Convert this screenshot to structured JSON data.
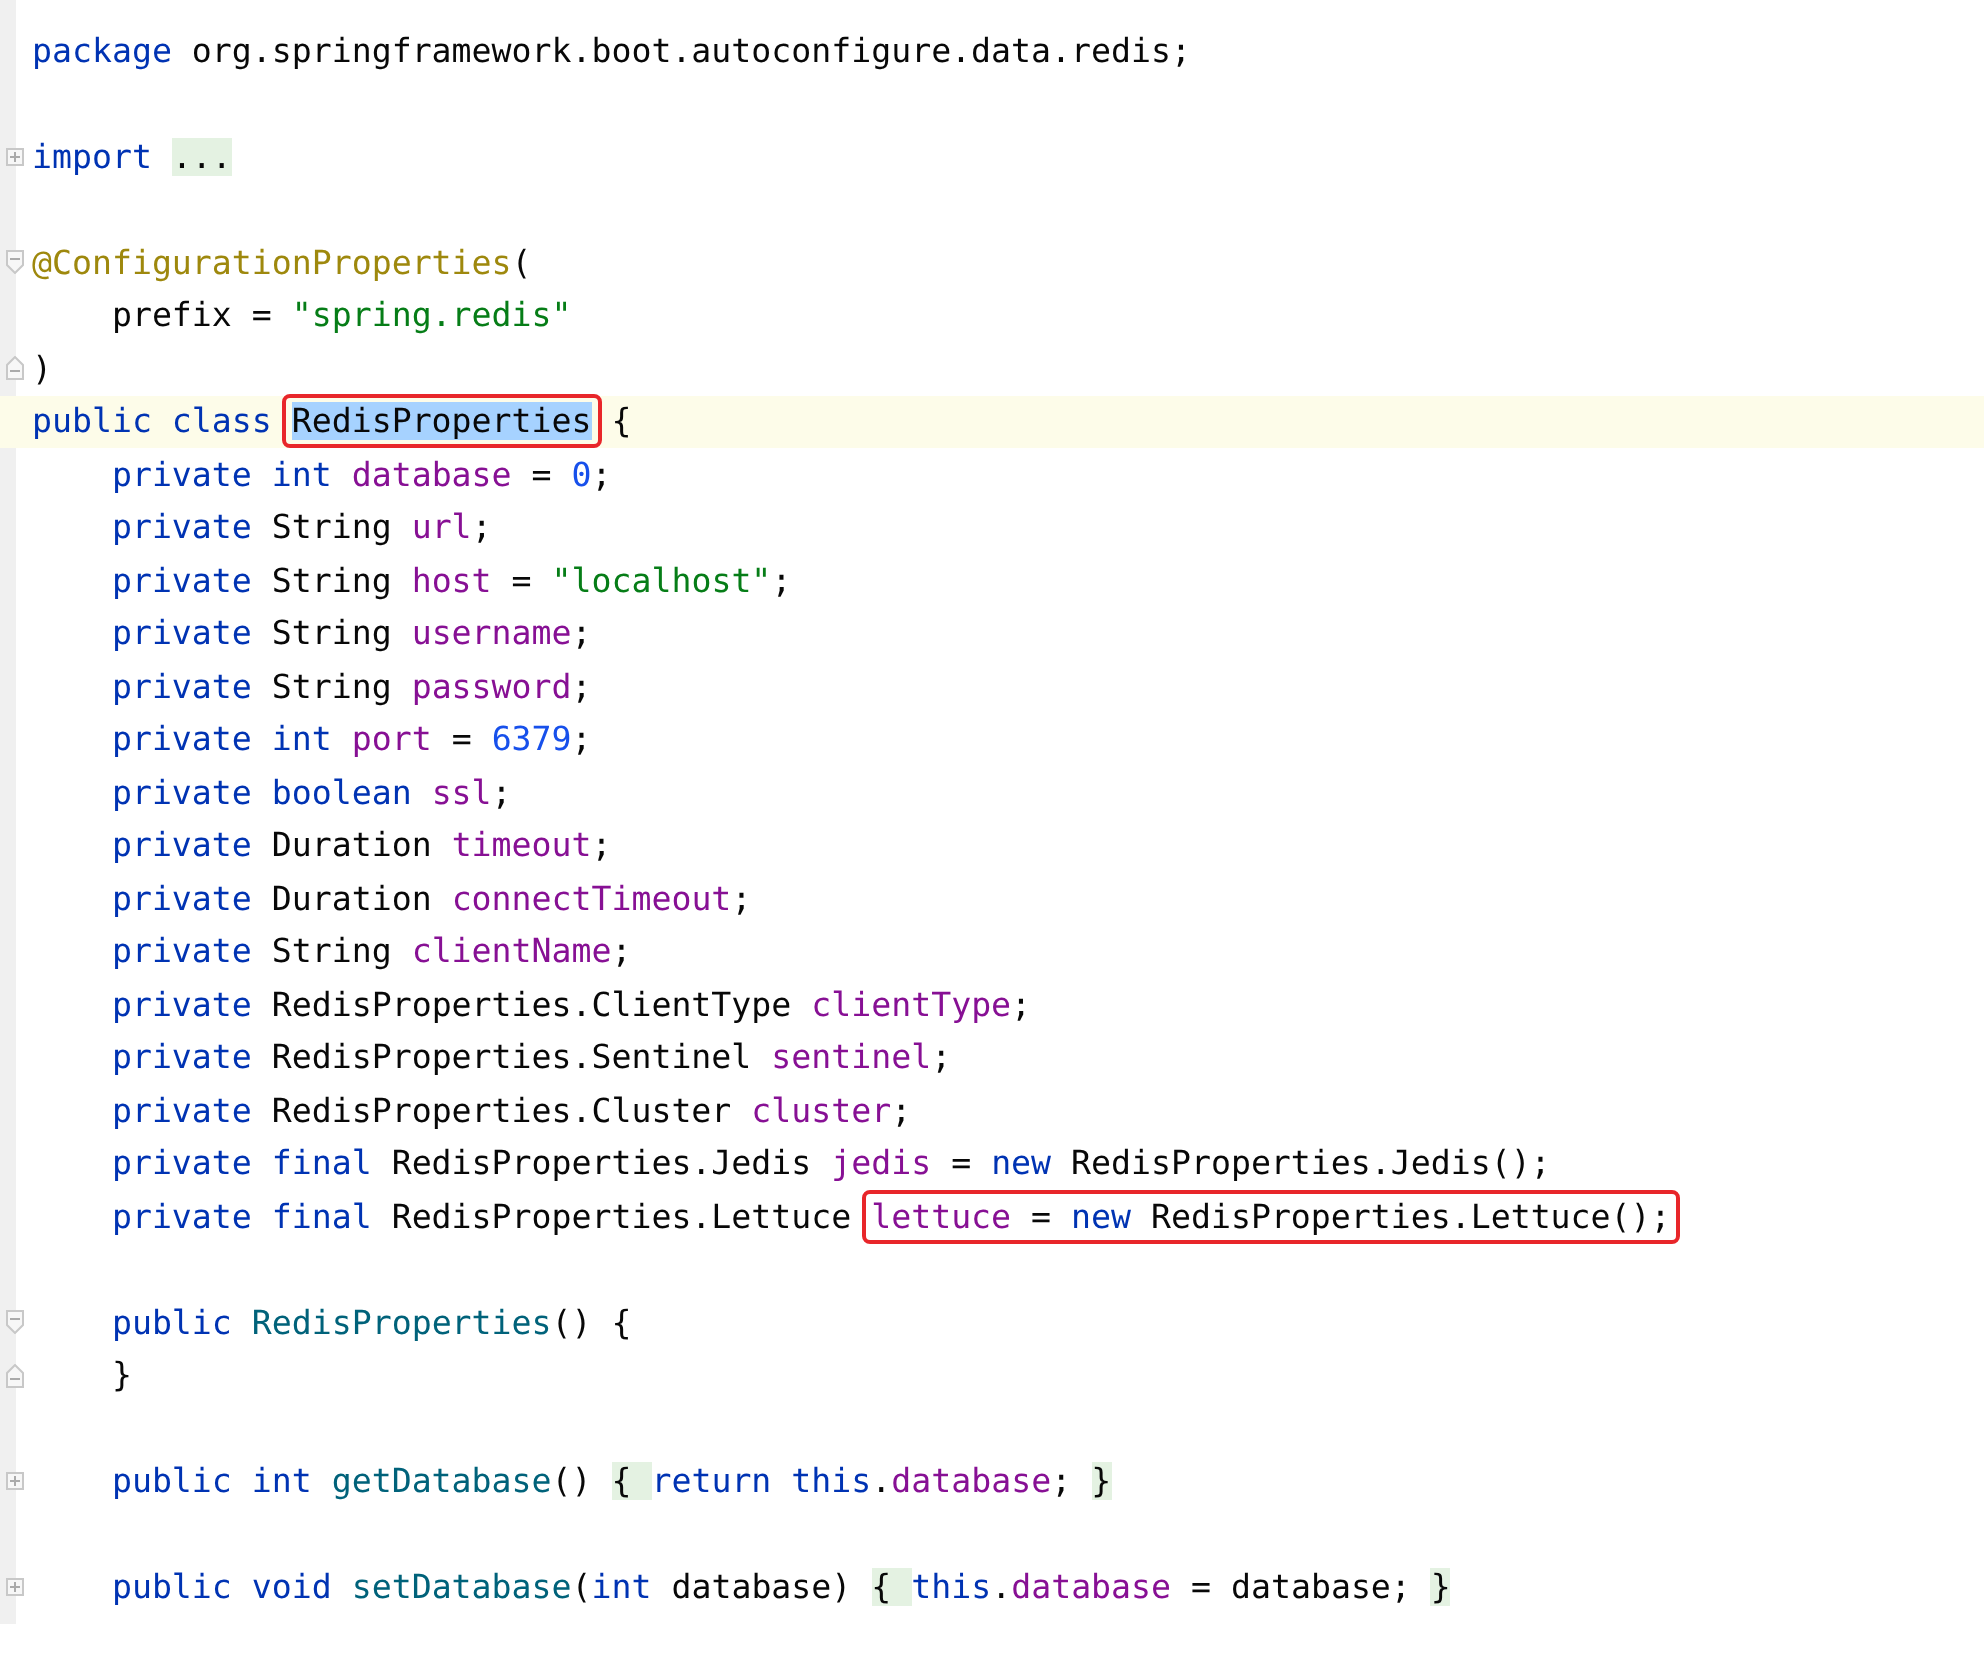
{
  "editor": {
    "lines": [
      {
        "current": false,
        "tokens": [
          {
            "kind": "keyword",
            "text": "package"
          },
          {
            "kind": "plain",
            "text": " org.springframework.boot.autoconfigure.data.redis;"
          }
        ]
      },
      {
        "current": false
      },
      {
        "current": false,
        "marker": {
          "kind": "expand"
        },
        "tokens": [
          {
            "kind": "keyword",
            "text": "import "
          },
          {
            "kind": "folded",
            "text": "..."
          }
        ]
      },
      {
        "current": false
      },
      {
        "current": false,
        "marker": {
          "kind": "start"
        },
        "tokens": [
          {
            "kind": "annotation",
            "text": "@ConfigurationProperties"
          },
          {
            "kind": "plain",
            "text": "("
          }
        ]
      },
      {
        "current": false,
        "tokens": [
          {
            "kind": "plain",
            "text": "    prefix = "
          },
          {
            "kind": "string",
            "text": "\"spring.redis\""
          }
        ]
      },
      {
        "current": false,
        "marker": {
          "kind": "end"
        },
        "tokens": [
          {
            "kind": "plain",
            "text": ")"
          }
        ]
      },
      {
        "current": true,
        "tokens": [
          {
            "kind": "keyword",
            "text": "public class "
          },
          {
            "kind": "selected",
            "text": "RedisProperties",
            "boxed": true
          },
          {
            "kind": "plain",
            "text": " {"
          }
        ]
      },
      {
        "current": false,
        "tokens": [
          {
            "kind": "keyword",
            "text": "    private int "
          },
          {
            "kind": "field",
            "text": "database"
          },
          {
            "kind": "plain",
            "text": " = "
          },
          {
            "kind": "number",
            "text": "0"
          },
          {
            "kind": "plain",
            "text": ";"
          }
        ]
      },
      {
        "current": false,
        "tokens": [
          {
            "kind": "keyword",
            "text": "    private "
          },
          {
            "kind": "plain",
            "text": "String "
          },
          {
            "kind": "field",
            "text": "url"
          },
          {
            "kind": "plain",
            "text": ";"
          }
        ]
      },
      {
        "current": false,
        "tokens": [
          {
            "kind": "keyword",
            "text": "    private "
          },
          {
            "kind": "plain",
            "text": "String "
          },
          {
            "kind": "field",
            "text": "host"
          },
          {
            "kind": "plain",
            "text": " = "
          },
          {
            "kind": "string",
            "text": "\"localhost\""
          },
          {
            "kind": "plain",
            "text": ";"
          }
        ]
      },
      {
        "current": false,
        "tokens": [
          {
            "kind": "keyword",
            "text": "    private "
          },
          {
            "kind": "plain",
            "text": "String "
          },
          {
            "kind": "field",
            "text": "username"
          },
          {
            "kind": "plain",
            "text": ";"
          }
        ]
      },
      {
        "current": false,
        "tokens": [
          {
            "kind": "keyword",
            "text": "    private "
          },
          {
            "kind": "plain",
            "text": "String "
          },
          {
            "kind": "field",
            "text": "password"
          },
          {
            "kind": "plain",
            "text": ";"
          }
        ]
      },
      {
        "current": false,
        "tokens": [
          {
            "kind": "keyword",
            "text": "    private int "
          },
          {
            "kind": "field",
            "text": "port"
          },
          {
            "kind": "plain",
            "text": " = "
          },
          {
            "kind": "number",
            "text": "6379"
          },
          {
            "kind": "plain",
            "text": ";"
          }
        ]
      },
      {
        "current": false,
        "tokens": [
          {
            "kind": "keyword",
            "text": "    private boolean "
          },
          {
            "kind": "field",
            "text": "ssl"
          },
          {
            "kind": "plain",
            "text": ";"
          }
        ]
      },
      {
        "current": false,
        "tokens": [
          {
            "kind": "keyword",
            "text": "    private "
          },
          {
            "kind": "plain",
            "text": "Duration "
          },
          {
            "kind": "field",
            "text": "timeout"
          },
          {
            "kind": "plain",
            "text": ";"
          }
        ]
      },
      {
        "current": false,
        "tokens": [
          {
            "kind": "keyword",
            "text": "    private "
          },
          {
            "kind": "plain",
            "text": "Duration "
          },
          {
            "kind": "field",
            "text": "connectTimeout"
          },
          {
            "kind": "plain",
            "text": ";"
          }
        ]
      },
      {
        "current": false,
        "tokens": [
          {
            "kind": "keyword",
            "text": "    private "
          },
          {
            "kind": "plain",
            "text": "String "
          },
          {
            "kind": "field",
            "text": "clientName"
          },
          {
            "kind": "plain",
            "text": ";"
          }
        ]
      },
      {
        "current": false,
        "tokens": [
          {
            "kind": "keyword",
            "text": "    private "
          },
          {
            "kind": "plain",
            "text": "RedisProperties.ClientType "
          },
          {
            "kind": "field",
            "text": "clientType"
          },
          {
            "kind": "plain",
            "text": ";"
          }
        ]
      },
      {
        "current": false,
        "tokens": [
          {
            "kind": "keyword",
            "text": "    private "
          },
          {
            "kind": "plain",
            "text": "RedisProperties.Sentinel "
          },
          {
            "kind": "field",
            "text": "sentinel"
          },
          {
            "kind": "plain",
            "text": ";"
          }
        ]
      },
      {
        "current": false,
        "tokens": [
          {
            "kind": "keyword",
            "text": "    private "
          },
          {
            "kind": "plain",
            "text": "RedisProperties.Cluster "
          },
          {
            "kind": "field",
            "text": "cluster"
          },
          {
            "kind": "plain",
            "text": ";"
          }
        ]
      },
      {
        "current": false,
        "tokens": [
          {
            "kind": "keyword",
            "text": "    private final "
          },
          {
            "kind": "plain",
            "text": "RedisProperties.Jedis "
          },
          {
            "kind": "field",
            "text": "jedis"
          },
          {
            "kind": "plain",
            "text": " = "
          },
          {
            "kind": "keyword",
            "text": "new "
          },
          {
            "kind": "plain",
            "text": "RedisProperties.Jedis();"
          }
        ]
      },
      {
        "current": false,
        "tokens": [
          {
            "kind": "keyword",
            "text": "    private final "
          },
          {
            "kind": "plain",
            "text": "RedisProperties.Lettuce "
          },
          {
            "kind": "field",
            "text": "lettuce",
            "boxed": true
          },
          {
            "kind": "plain",
            "text": " = ",
            "boxed": true
          },
          {
            "kind": "keyword",
            "text": "new ",
            "boxed": true
          },
          {
            "kind": "plain",
            "text": "RedisProperties.Lettuce();",
            "boxed": true
          }
        ]
      },
      {
        "current": false
      },
      {
        "current": false,
        "marker": {
          "kind": "start"
        },
        "tokens": [
          {
            "kind": "keyword",
            "text": "    public "
          },
          {
            "kind": "method",
            "text": "RedisProperties"
          },
          {
            "kind": "plain",
            "text": "() {"
          }
        ]
      },
      {
        "current": false,
        "marker": {
          "kind": "end"
        },
        "tokens": [
          {
            "kind": "plain",
            "text": "    }"
          }
        ]
      },
      {
        "current": false
      },
      {
        "current": false,
        "marker": {
          "kind": "expand"
        },
        "tokens": [
          {
            "kind": "keyword",
            "text": "    public int "
          },
          {
            "kind": "method",
            "text": "getDatabase"
          },
          {
            "kind": "plain",
            "text": "() "
          },
          {
            "kind": "folded",
            "text": "{ "
          },
          {
            "kind": "keyword",
            "text": "return this"
          },
          {
            "kind": "plain",
            "text": "."
          },
          {
            "kind": "field",
            "text": "database"
          },
          {
            "kind": "plain",
            "text": "; "
          },
          {
            "kind": "folded",
            "text": "}"
          }
        ]
      },
      {
        "current": false
      },
      {
        "current": false,
        "marker": {
          "kind": "expand"
        },
        "tokens": [
          {
            "kind": "keyword",
            "text": "    public void "
          },
          {
            "kind": "method",
            "text": "setDatabase"
          },
          {
            "kind": "plain",
            "text": "("
          },
          {
            "kind": "keyword",
            "text": "int "
          },
          {
            "kind": "plain",
            "text": "database) "
          },
          {
            "kind": "folded",
            "text": "{ "
          },
          {
            "kind": "keyword",
            "text": "this"
          },
          {
            "kind": "plain",
            "text": "."
          },
          {
            "kind": "field",
            "text": "database"
          },
          {
            "kind": "plain",
            "text": " = database; "
          },
          {
            "kind": "folded",
            "text": "}"
          }
        ]
      }
    ]
  }
}
